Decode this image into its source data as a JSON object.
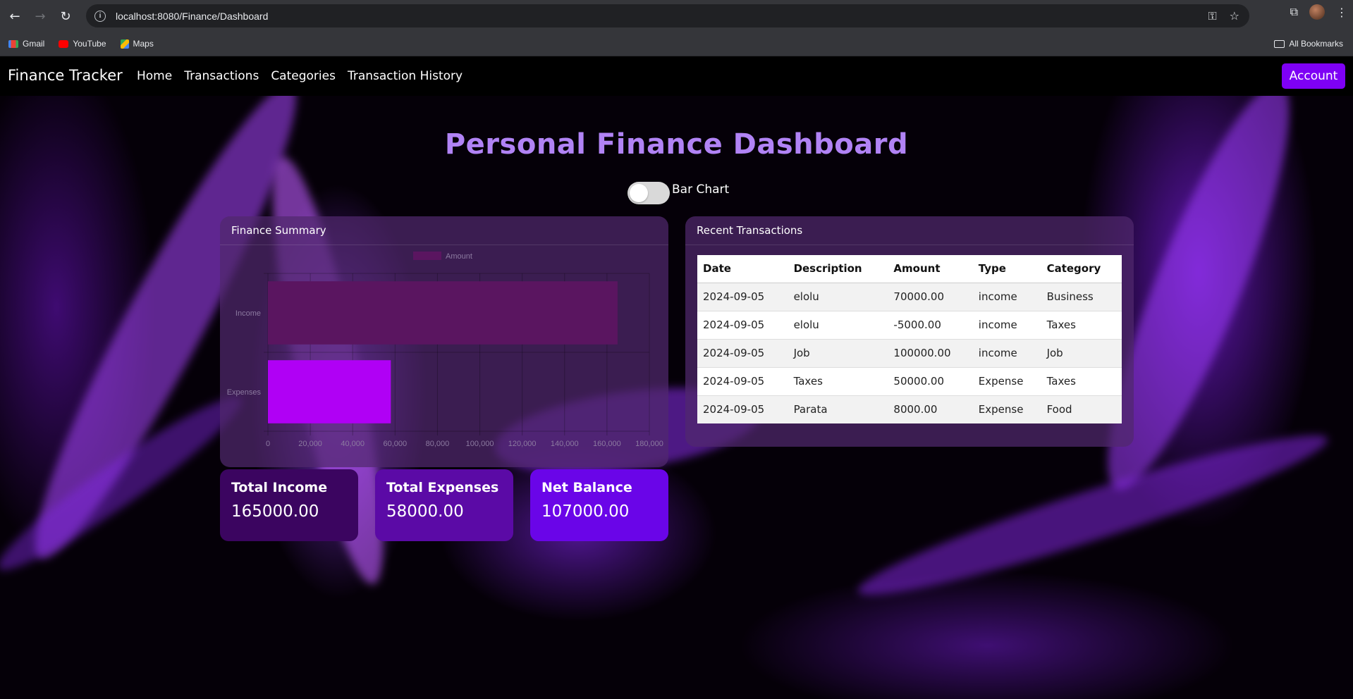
{
  "browser": {
    "url": "localhost:8080/Finance/Dashboard",
    "bookmarks": [
      "Gmail",
      "YouTube",
      "Maps"
    ],
    "all_bookmarks": "All Bookmarks"
  },
  "navbar": {
    "brand": "Finance Tracker",
    "links": [
      "Home",
      "Transactions",
      "Categories",
      "Transaction History"
    ],
    "account": "Account"
  },
  "page_title": "Personal Finance Dashboard",
  "toggle_label": "Bar Chart",
  "summary_card": {
    "title": "Finance Summary"
  },
  "chart_data": {
    "type": "bar",
    "orientation": "horizontal",
    "categories": [
      "Income",
      "Expenses"
    ],
    "series": [
      {
        "name": "Amount",
        "values": [
          165000,
          58000
        ],
        "colors": [
          "#5a1560",
          "#b000f5"
        ]
      }
    ],
    "xlim": [
      0,
      180000
    ],
    "xticks": [
      "0",
      "20,000",
      "40,000",
      "60,000",
      "80,000",
      "100,000",
      "120,000",
      "140,000",
      "160,000",
      "180,000"
    ],
    "grid": true,
    "legend": "top-center"
  },
  "transactions": {
    "title": "Recent Transactions",
    "columns": [
      "Date",
      "Description",
      "Amount",
      "Type",
      "Category"
    ],
    "rows": [
      [
        "2024-09-05",
        "elolu",
        "70000.00",
        "income",
        "Business"
      ],
      [
        "2024-09-05",
        "elolu",
        "-5000.00",
        "income",
        "Taxes"
      ],
      [
        "2024-09-05",
        "Job",
        "100000.00",
        "income",
        "Job"
      ],
      [
        "2024-09-05",
        "Taxes",
        "50000.00",
        "Expense",
        "Taxes"
      ],
      [
        "2024-09-05",
        "Parata",
        "8000.00",
        "Expense",
        "Food"
      ]
    ]
  },
  "stats": {
    "income": {
      "label": "Total Income",
      "value": "165000.00"
    },
    "expenses": {
      "label": "Total Expenses",
      "value": "58000.00"
    },
    "balance": {
      "label": "Net Balance",
      "value": "107000.00"
    }
  }
}
